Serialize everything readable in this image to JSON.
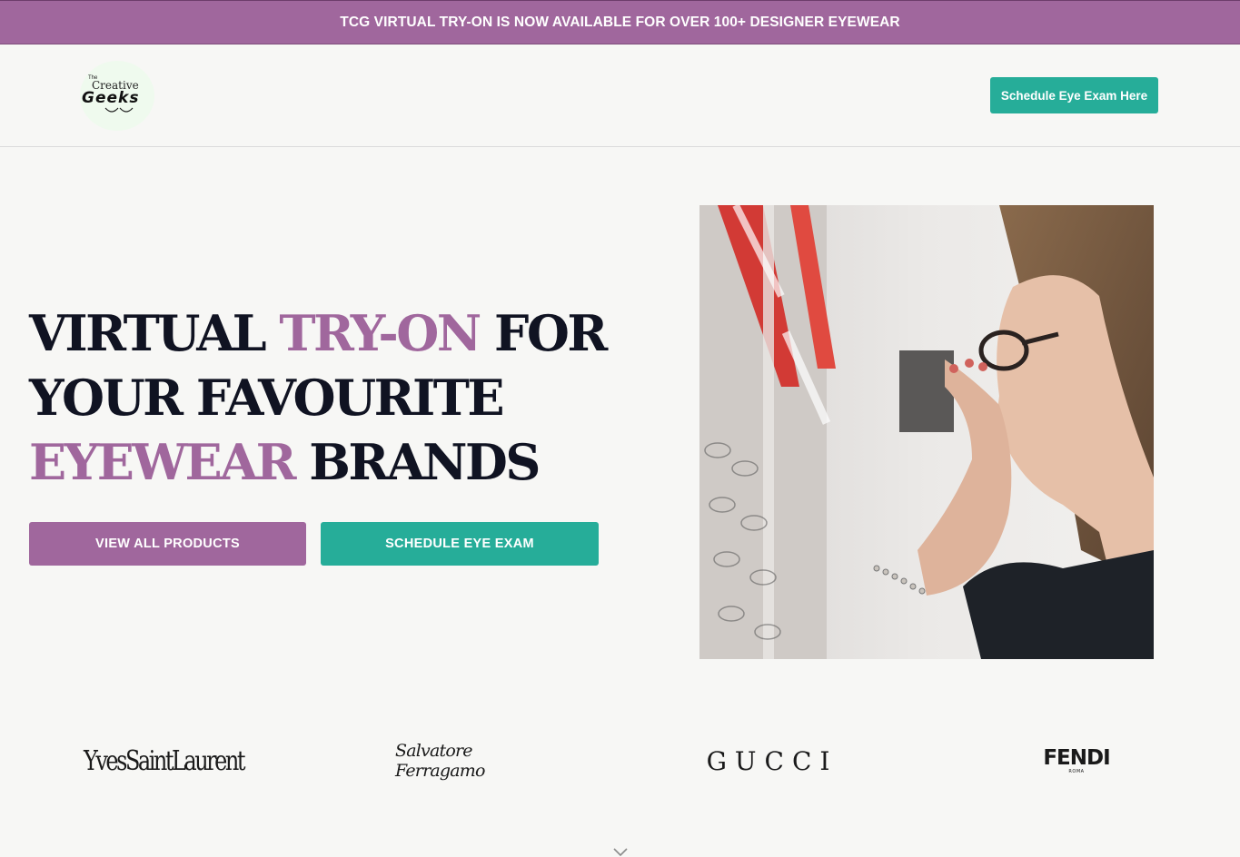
{
  "announcement": "TCG VIRTUAL TRY-ON IS NOW AVAILABLE FOR OVER 100+ DESIGNER EYEWEAR",
  "header": {
    "logo": {
      "small": "The",
      "line1": "Creative",
      "line2": "Geeks"
    },
    "cta_label": "Schedule Eye Exam Here"
  },
  "hero": {
    "title_parts": {
      "p1": "VIRTUAL ",
      "p2": "TRY-ON",
      "p3": " FOR YOUR FAVOURITE ",
      "p4": "EYEWEAR",
      "p5": " BRANDS"
    },
    "btn_products": "VIEW ALL PRODUCTS",
    "btn_exam": "SCHEDULE EYE EXAM"
  },
  "brands": {
    "ysl": "YvesSaintLaurent",
    "ferragamo": "Salvatore Ferragamo",
    "gucci": "GUCCI",
    "fendi": "FENDI",
    "fendi_sub": "ROMA"
  },
  "colors": {
    "purple": "#a0679d",
    "teal": "#26ad99",
    "dark": "#101322",
    "bg": "#f7f7f5"
  },
  "icons": [
    "logo-glasses-icon",
    "chevron-down-icon"
  ]
}
